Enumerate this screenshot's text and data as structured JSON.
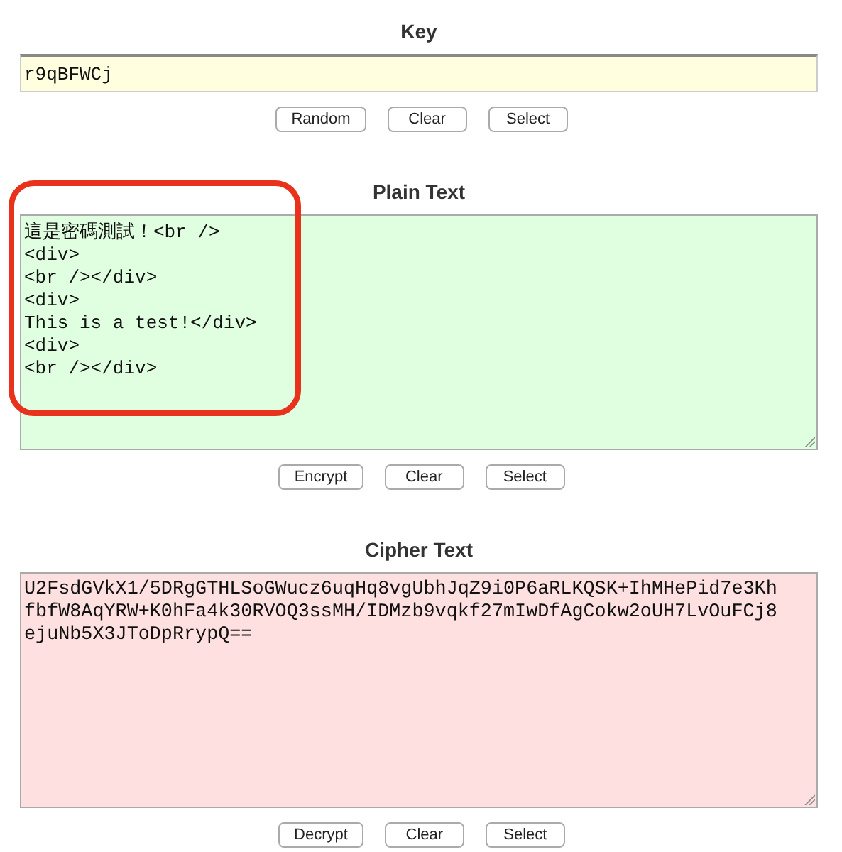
{
  "sections": [
    {
      "kind": "key",
      "title": "Key",
      "value": "r9qBFWCj",
      "buttons": [
        "Random",
        "Clear",
        "Select"
      ]
    },
    {
      "kind": "plain",
      "title": "Plain Text",
      "value": "這是密碼測試！<br />\n<div>\n<br /></div>\n<div>\nThis is a test!</div>\n<div>\n<br /></div>",
      "buttons": [
        "Encrypt",
        "Clear",
        "Select"
      ],
      "annotations": [
        {
          "kind": "outline"
        }
      ]
    },
    {
      "kind": "cipher",
      "title": "Cipher Text",
      "value": "U2FsdGVkX1/5DRgGTHLSoGWucz6uqHq8vgUbhJqZ9i0P6aRLKQSK+IhMHePid7e3Kh\nfbfW8AqYRW+K0hFa4k30RVOQ3ssMH/IDMzb9vqkf27mIwDfAgCokw2oUH7LvOuFCj8\nejuNb5X3JToDpRrypQ==",
      "buttons": [
        "Decrypt",
        "Clear",
        "Select"
      ]
    }
  ]
}
